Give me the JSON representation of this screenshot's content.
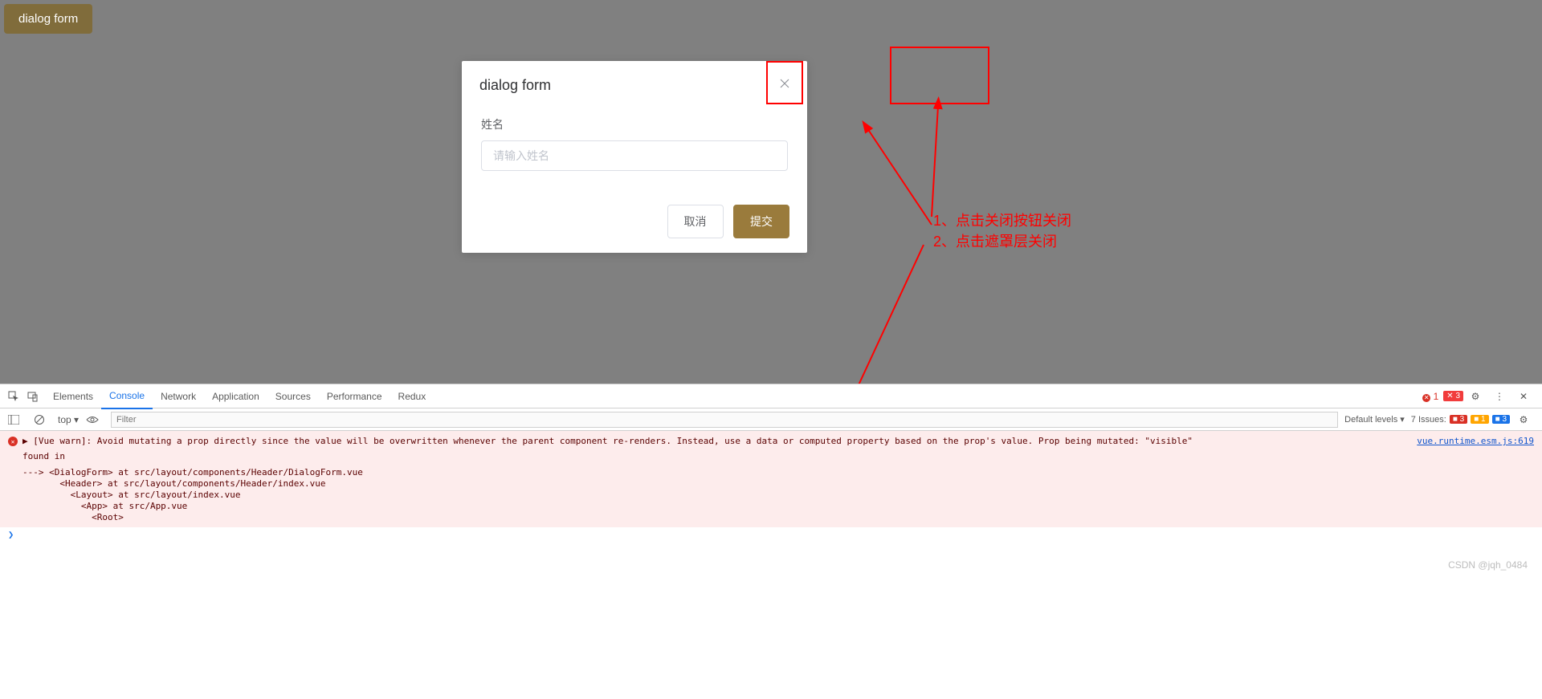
{
  "trigger_button": "dialog form",
  "dialog": {
    "title": "dialog form",
    "form": {
      "name_label": "姓名",
      "name_placeholder": "请输入姓名"
    },
    "footer": {
      "cancel": "取消",
      "submit": "提交"
    }
  },
  "annotations": {
    "line1": "1、点击关闭按钮关闭",
    "line2": "2、点击遮罩层关闭"
  },
  "devtools": {
    "tabs": [
      "Elements",
      "Console",
      "Network",
      "Application",
      "Sources",
      "Performance",
      "Redux"
    ],
    "active_tab": "Console",
    "error_count": "1",
    "warn_badge": "3",
    "context": "top",
    "filter_placeholder": "Filter",
    "levels": "Default levels ▾",
    "issues_label": "7 Issues:",
    "issues": {
      "red": "3",
      "yellow": "1",
      "blue": "3"
    },
    "console": {
      "warn_msg": "[Vue warn]: Avoid mutating a prop directly since the value will be overwritten whenever the parent component re-renders. Instead, use a data or computed property based on the prop's value. Prop being mutated: \"visible\"",
      "source_link": "vue.runtime.esm.js:619",
      "found_in": "found in",
      "trace": "---> <DialogForm> at src/layout/components/Header/DialogForm.vue\n       <Header> at src/layout/components/Header/index.vue\n         <Layout> at src/layout/index.vue\n           <App> at src/App.vue\n             <Root>"
    }
  },
  "watermark": "CSDN @jqh_0484"
}
